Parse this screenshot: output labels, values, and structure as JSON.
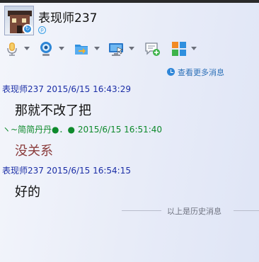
{
  "contact": {
    "name": "表现师237"
  },
  "history_link": {
    "label": "查看更多消息"
  },
  "messages": [
    {
      "sender": "表现师237",
      "timestamp": "2015/6/15 16:43:29",
      "text": "那就不改了把"
    },
    {
      "sender": "ヽ~简简丹丹●．●",
      "timestamp": "2015/6/15 16:51:40",
      "text": "没关系"
    },
    {
      "sender": "表现师237",
      "timestamp": "2015/6/15 16:54:15",
      "text": "好的"
    }
  ],
  "history_divider": {
    "label": "以上是历史消息"
  },
  "colors": {
    "self_sender": "#1b2ea6",
    "other_sender": "#0e8a2c",
    "other_message": "#8a3b3b",
    "link": "#2a6fb7"
  },
  "toolbar": {
    "icons": [
      "microphone-icon",
      "webcam-icon",
      "send-file-icon",
      "screen-share-icon",
      "chat-add-icon",
      "apps-grid-icon"
    ]
  }
}
